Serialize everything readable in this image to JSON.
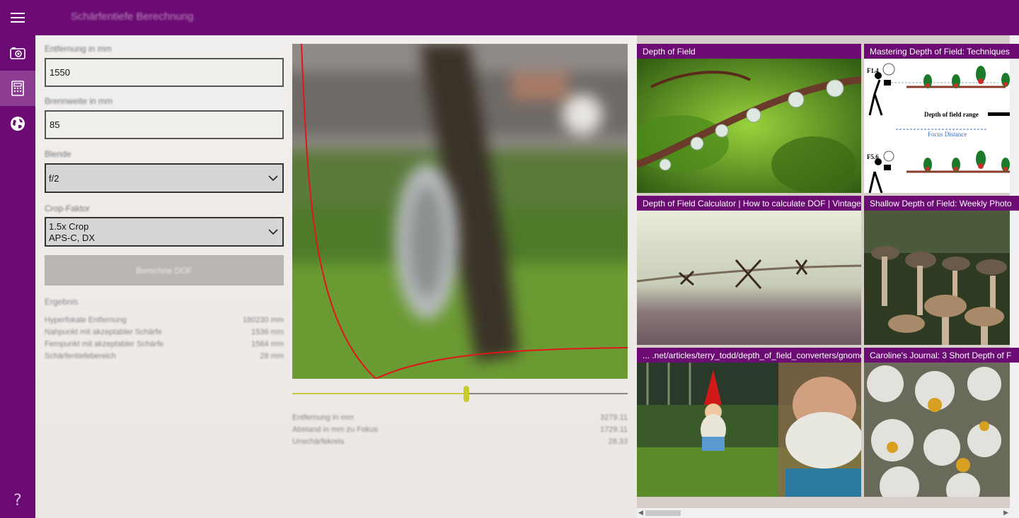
{
  "window": {
    "title": "Schärfentiefe Berechnung"
  },
  "sidebar": {
    "items": [
      {
        "icon": "camera-icon",
        "active": false
      },
      {
        "icon": "calculator-icon",
        "active": true
      },
      {
        "icon": "globe-icon",
        "active": false
      }
    ],
    "help": "?"
  },
  "form": {
    "distance": {
      "label": "Entfernung in mm",
      "value": "1550"
    },
    "focal": {
      "label": "Brennweite in mm",
      "value": "85"
    },
    "aperture": {
      "label": "Blende",
      "value": "f/2"
    },
    "crop": {
      "label": "Crop-Faktor",
      "value_line1": "1.5x Crop",
      "value_line2": "APS-C, DX"
    },
    "calc_button": "Berechne DOF"
  },
  "results": {
    "title": "Ergebnis",
    "rows": [
      {
        "label": "Hyperfokale Entfernung",
        "value": "180230 mm"
      },
      {
        "label": "Nahpunkt mit akzeptabler Schärfe",
        "value": "1536 mm"
      },
      {
        "label": "Fernpunkt mit akzeptabler Schärfe",
        "value": "1564 mm"
      },
      {
        "label": "Schärfentiefebereich",
        "value": "28 mm"
      }
    ]
  },
  "slider": {
    "value": 0.52
  },
  "info": {
    "rows": [
      {
        "label": "Entfernung in mm",
        "value": "3279.11"
      },
      {
        "label": "Abstand in mm zu Fokus",
        "value": "1729.11"
      },
      {
        "label": "Unschärfekreis",
        "value": "28.33"
      }
    ]
  },
  "colors": {
    "accent": "#6b0b73",
    "curve": "#e0161a",
    "slider": "#c7cc2e"
  },
  "gallery": {
    "tiles": [
      {
        "caption": "Depth of Field",
        "image": "water-droplets-on-twig"
      },
      {
        "caption": "Mastering Depth of Field: Techniques",
        "image": "dof-diagram-photographer-birds"
      },
      {
        "caption": "Depth of Field Calculator | How to calculate DOF | Vintage",
        "image": "barbed-wire"
      },
      {
        "caption": "Shallow Depth of Field: Weekly Photo",
        "image": "mushrooms"
      },
      {
        "caption": "... .net/articles/terry_todd/depth_of_field_converters/gnome",
        "image": "garden-gnomes"
      },
      {
        "caption": "Caroline's Journal: 3 Short Depth of F",
        "image": "daisies"
      }
    ],
    "diagram": {
      "label_top": "F1.4",
      "label_range": "Depth of field range",
      "label_focus": "Focus Distance",
      "label_bottom": "F5.6"
    }
  }
}
